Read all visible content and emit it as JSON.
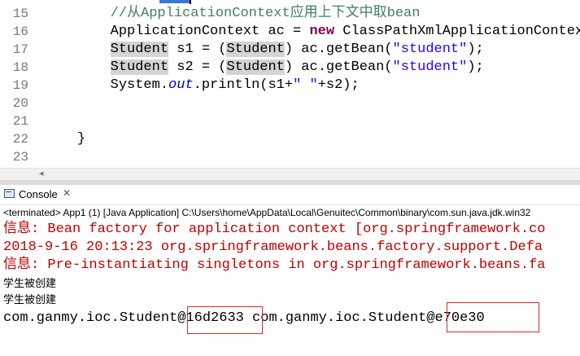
{
  "editor": {
    "lines": [
      {
        "num": "15",
        "indent": "        ",
        "tokens": [
          {
            "t": "//从ApplicationContext应用上下文中取bean",
            "c": "cmt"
          }
        ]
      },
      {
        "num": "16",
        "indent": "        ",
        "tokens": [
          {
            "t": "ApplicationContext ac = ",
            "c": ""
          },
          {
            "t": "new",
            "c": "kw"
          },
          {
            "t": " ClassPathXmlApplicationContext",
            "c": ""
          }
        ]
      },
      {
        "num": "17",
        "indent": "        ",
        "tokens": [
          {
            "t": "Student",
            "c": "hl"
          },
          {
            "t": " s1 = (",
            "c": ""
          },
          {
            "t": "Student",
            "c": "hl"
          },
          {
            "t": ") ac.getBean(",
            "c": ""
          },
          {
            "t": "\"student\"",
            "c": "str"
          },
          {
            "t": ");",
            "c": ""
          }
        ]
      },
      {
        "num": "18",
        "indent": "        ",
        "tokens": [
          {
            "t": "Student",
            "c": "hl"
          },
          {
            "t": " s2 = (",
            "c": ""
          },
          {
            "t": "Student",
            "c": "hl"
          },
          {
            "t": ") ac.getBean(",
            "c": ""
          },
          {
            "t": "\"student\"",
            "c": "str"
          },
          {
            "t": ");",
            "c": ""
          }
        ]
      },
      {
        "num": "19",
        "indent": "        ",
        "tokens": [
          {
            "t": "System.",
            "c": ""
          },
          {
            "t": "out",
            "c": "it"
          },
          {
            "t": ".println(s1+",
            "c": ""
          },
          {
            "t": "\" \"",
            "c": "str"
          },
          {
            "t": "+s2);",
            "c": ""
          }
        ]
      },
      {
        "num": "20",
        "indent": "",
        "tokens": []
      },
      {
        "num": "21",
        "indent": "",
        "tokens": []
      },
      {
        "num": "22",
        "indent": "    ",
        "tokens": [
          {
            "t": "}",
            "c": ""
          }
        ]
      },
      {
        "num": "23",
        "indent": "",
        "tokens": []
      }
    ]
  },
  "console": {
    "tab_label": "Console",
    "close_glyph": "✕",
    "status": "<terminated> App1 (1) [Java Application] C:\\Users\\home\\AppData\\Local\\Genuitec\\Common\\binary\\com.sun.java.jdk.win32",
    "output": [
      {
        "text": "信息: Bean factory for application context [org.springframework.co",
        "style": "red"
      },
      {
        "text": "2018-9-16 20:13:23 org.springframework.beans.factory.support.Defa",
        "style": "red"
      },
      {
        "text": "信息: Pre-instantiating singletons in org.springframework.beans.fa",
        "style": "red"
      },
      {
        "text": "学生被创建",
        "style": "cn"
      },
      {
        "text": "学生被创建",
        "style": "cn"
      },
      {
        "text": "com.ganmy.ioc.Student@16d2633 com.ganmy.ioc.Student@e70e30",
        "style": "blk"
      }
    ]
  },
  "colors": {
    "comment": "#3f7f5f",
    "keyword": "#7f0055",
    "string": "#2a00ff",
    "field": "#0000c0",
    "error_output": "#c00000",
    "highlight_box": "#d92a2a"
  }
}
